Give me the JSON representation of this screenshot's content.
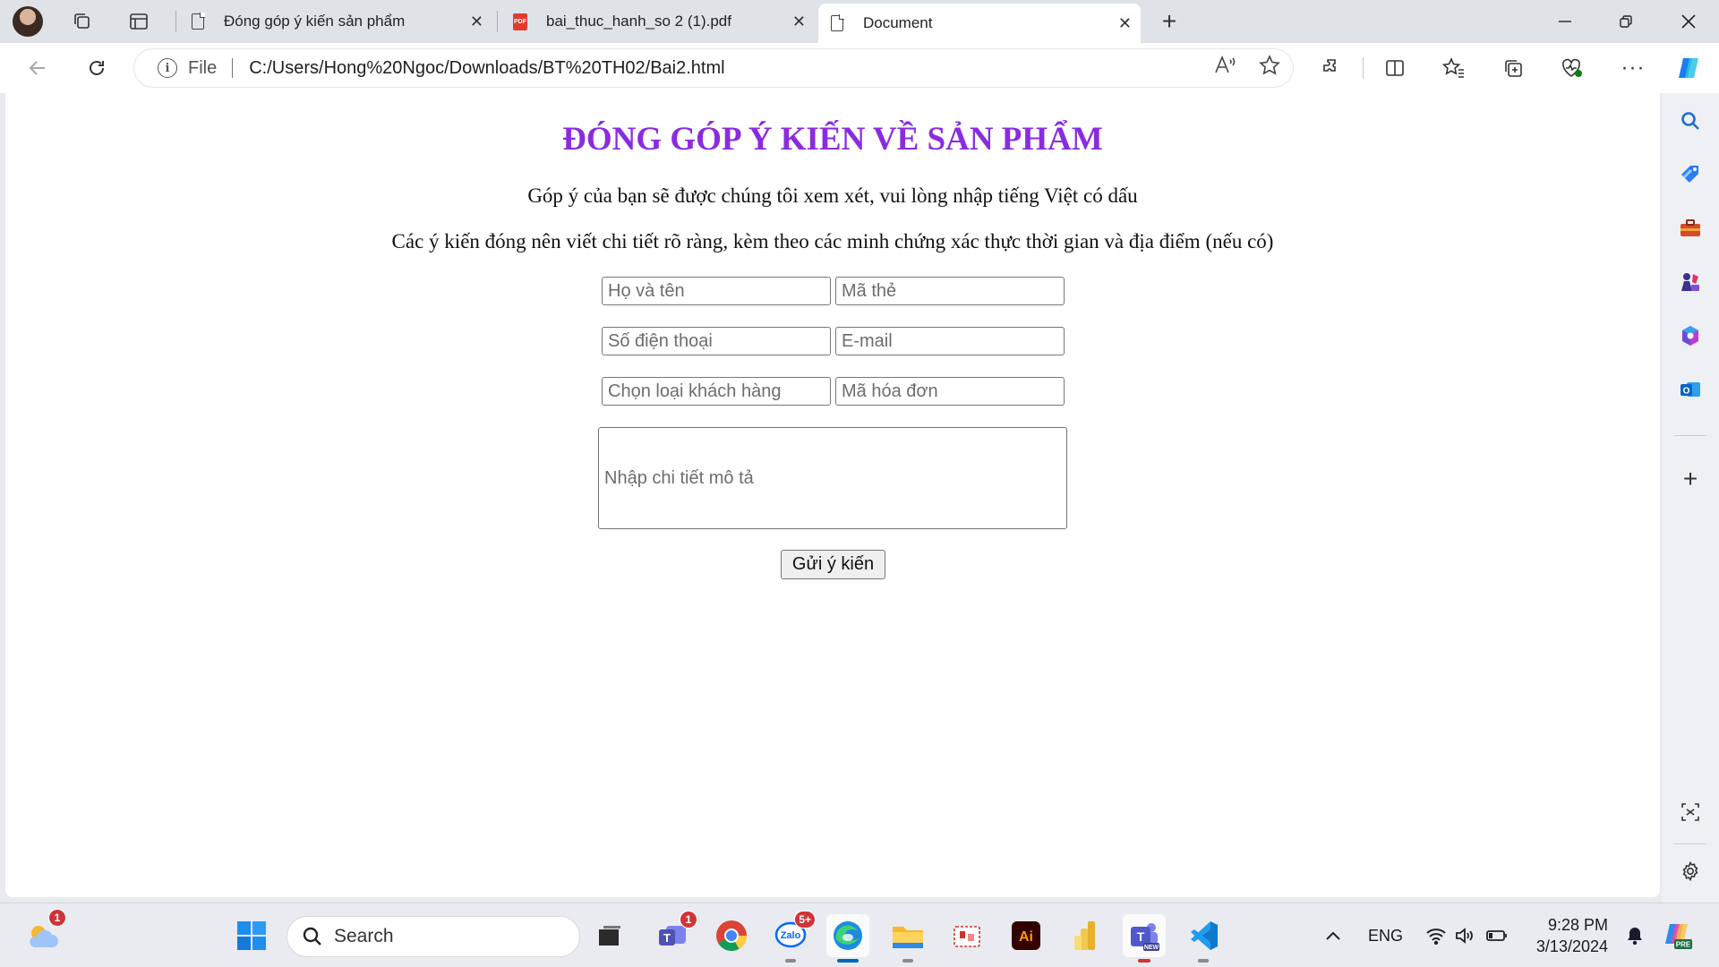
{
  "browser": {
    "tabs": [
      {
        "label": "Đóng góp ý kiến sản phẩm",
        "icon": "document-icon"
      },
      {
        "label": "bai_thuc_hanh_so 2 (1).pdf",
        "icon": "pdf-icon"
      },
      {
        "label": "Document",
        "icon": "document-icon",
        "active": true
      }
    ],
    "address": {
      "scheme": "File",
      "url": "C:/Users/Hong%20Ngoc/Downloads/BT%20TH02/Bai2.html"
    }
  },
  "page": {
    "title": "ĐÓNG GÓP Ý KIẾN VỀ SẢN PHẨM",
    "line1": "Góp ý của bạn sẽ được chúng tôi xem xét, vui lòng nhập tiếng Việt có dấu",
    "line2": "Các ý kiến đóng nên viết chi tiết rõ ràng, kèm theo các minh chứng xác thực thời gian và địa điểm (nếu có)",
    "form": {
      "name_placeholder": "Họ và tên",
      "card_placeholder": "Mã thẻ",
      "phone_placeholder": "Số điện thoại",
      "email_placeholder": "E-mail",
      "customer_type_placeholder": "Chọn loại khách hàng",
      "invoice_placeholder": "Mã hóa đơn",
      "description_placeholder": "Nhập chi tiết mô tả",
      "submit_label": "Gửi ý kiến"
    },
    "title_color": "#8a2be2"
  },
  "taskbar": {
    "search_label": "Search",
    "weather_badge": "1",
    "teams_badge": "1",
    "zalo_badge": "5+",
    "language": "ENG",
    "time": "9:28 PM",
    "date": "3/13/2024"
  }
}
